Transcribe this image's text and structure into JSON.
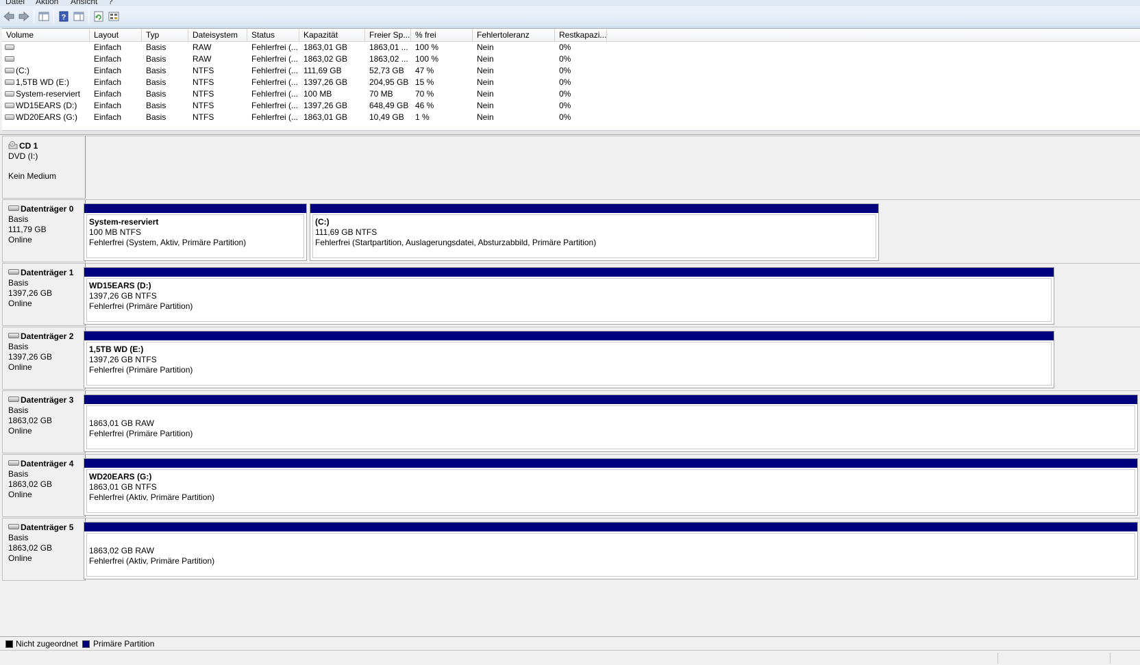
{
  "menu": [
    "Datei",
    "Aktion",
    "Ansicht",
    "?"
  ],
  "toolbar": [
    "back-icon",
    "forward-icon",
    "console-tree-icon",
    "help-icon",
    "properties-icon",
    "refresh-icon",
    "rescan-disks-icon"
  ],
  "volume_table": {
    "columns": [
      "Volume",
      "Layout",
      "Typ",
      "Dateisystem",
      "Status",
      "Kapazität",
      "Freier Sp...",
      "% frei",
      "Fehlertoleranz",
      "Restkapazi..."
    ],
    "rows": [
      {
        "volume": "",
        "layout": "Einfach",
        "typ": "Basis",
        "fs": "RAW",
        "status": "Fehlerfrei (...",
        "capacity": "1863,01 GB",
        "free": "1863,01 ...",
        "pct": "100 %",
        "fault": "Nein",
        "overhead": "0%"
      },
      {
        "volume": "",
        "layout": "Einfach",
        "typ": "Basis",
        "fs": "RAW",
        "status": "Fehlerfrei (...",
        "capacity": "1863,02 GB",
        "free": "1863,02 ...",
        "pct": "100 %",
        "fault": "Nein",
        "overhead": "0%"
      },
      {
        "volume": "(C:)",
        "layout": "Einfach",
        "typ": "Basis",
        "fs": "NTFS",
        "status": "Fehlerfrei (...",
        "capacity": "111,69 GB",
        "free": "52,73 GB",
        "pct": "47 %",
        "fault": "Nein",
        "overhead": "0%"
      },
      {
        "volume": "1,5TB WD (E:)",
        "layout": "Einfach",
        "typ": "Basis",
        "fs": "NTFS",
        "status": "Fehlerfrei (...",
        "capacity": "1397,26 GB",
        "free": "204,95 GB",
        "pct": "15 %",
        "fault": "Nein",
        "overhead": "0%"
      },
      {
        "volume": "System-reserviert",
        "layout": "Einfach",
        "typ": "Basis",
        "fs": "NTFS",
        "status": "Fehlerfrei (...",
        "capacity": "100 MB",
        "free": "70 MB",
        "pct": "70 %",
        "fault": "Nein",
        "overhead": "0%"
      },
      {
        "volume": "WD15EARS (D:)",
        "layout": "Einfach",
        "typ": "Basis",
        "fs": "NTFS",
        "status": "Fehlerfrei (...",
        "capacity": "1397,26 GB",
        "free": "648,49 GB",
        "pct": "46 %",
        "fault": "Nein",
        "overhead": "0%"
      },
      {
        "volume": "WD20EARS (G:)",
        "layout": "Einfach",
        "typ": "Basis",
        "fs": "NTFS",
        "status": "Fehlerfrei (...",
        "capacity": "1863,01 GB",
        "free": "10,49 GB",
        "pct": "1 %",
        "fault": "Nein",
        "overhead": "0%"
      }
    ]
  },
  "disks": [
    {
      "name": "CD 1",
      "lines": [
        "DVD (I:)",
        "",
        "Kein Medium"
      ],
      "icon": "cd-drive-icon",
      "partitions": []
    },
    {
      "name": "Datenträger 0",
      "lines": [
        "Basis",
        "111,79 GB",
        "Online"
      ],
      "icon": "disk-icon",
      "partitions": [
        {
          "name": "System-reserviert",
          "size": "100 MB NTFS",
          "status": "Fehlerfrei (System, Aktiv, Primäre Partition)"
        },
        {
          "name": "(C:)",
          "size": "111,69 GB NTFS",
          "status": "Fehlerfrei (Startpartition, Auslagerungsdatei, Absturzabbild, Primäre Partition)"
        }
      ]
    },
    {
      "name": "Datenträger 1",
      "lines": [
        "Basis",
        "1397,26 GB",
        "Online"
      ],
      "icon": "disk-icon",
      "partitions": [
        {
          "name": "WD15EARS  (D:)",
          "size": "1397,26 GB NTFS",
          "status": "Fehlerfrei (Primäre Partition)"
        }
      ]
    },
    {
      "name": "Datenträger 2",
      "lines": [
        "Basis",
        "1397,26 GB",
        "Online"
      ],
      "icon": "disk-icon",
      "partitions": [
        {
          "name": "1,5TB WD  (E:)",
          "size": "1397,26 GB NTFS",
          "status": "Fehlerfrei (Primäre Partition)"
        }
      ]
    },
    {
      "name": "Datenträger 3",
      "lines": [
        "Basis",
        "1863,02 GB",
        "Online"
      ],
      "icon": "disk-icon",
      "partitions": [
        {
          "name": "",
          "size": "1863,01 GB RAW",
          "status": "Fehlerfrei (Primäre Partition)"
        }
      ]
    },
    {
      "name": "Datenträger 4",
      "lines": [
        "Basis",
        "1863,02 GB",
        "Online"
      ],
      "icon": "disk-icon",
      "partitions": [
        {
          "name": "WD20EARS  (G:)",
          "size": "1863,01 GB NTFS",
          "status": "Fehlerfrei (Aktiv, Primäre Partition)"
        }
      ]
    },
    {
      "name": "Datenträger 5",
      "lines": [
        "Basis",
        "1863,02 GB",
        "Online"
      ],
      "icon": "disk-icon",
      "partitions": [
        {
          "name": "",
          "size": "1863,02 GB RAW",
          "status": "Fehlerfrei (Aktiv, Primäre Partition)"
        }
      ]
    }
  ],
  "legend": [
    {
      "label": "Nicht zugeordnet",
      "color": "#000000"
    },
    {
      "label": "Primäre Partition",
      "color": "#00007f"
    }
  ],
  "colors": {
    "primary_partition": "#00007f",
    "unallocated": "#000000"
  }
}
